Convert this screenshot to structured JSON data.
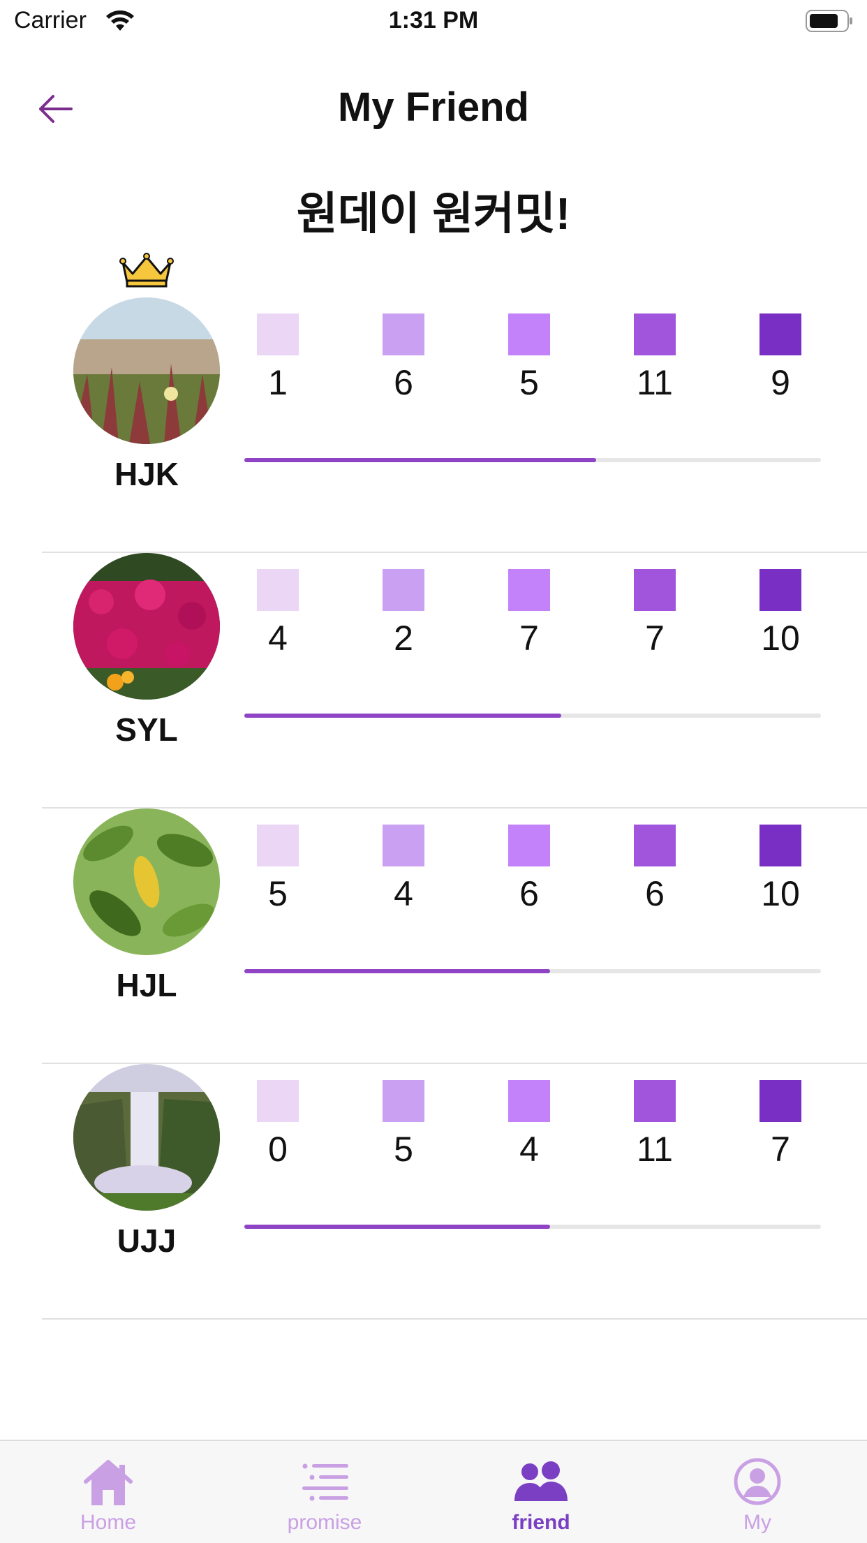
{
  "status_bar": {
    "carrier": "Carrier",
    "time": "1:31 PM"
  },
  "nav": {
    "title": "My Friend",
    "back_icon": "arrow-left-icon"
  },
  "subtitle": "원데이 원커밋!",
  "colors": {
    "accent": "#8e44c4",
    "square_colors": [
      "#ecd6f6",
      "#caa0f2",
      "#c382fa",
      "#a155dd",
      "#7a2fc4"
    ],
    "tab_inactive": "#c9a0e4",
    "tab_active": "#7b3fc4"
  },
  "friends": [
    {
      "name": "HJK",
      "crown": true,
      "counts": [
        "1",
        "6",
        "5",
        "11",
        "9"
      ],
      "progress": 0.61
    },
    {
      "name": "SYL",
      "crown": false,
      "counts": [
        "4",
        "2",
        "7",
        "7",
        "10"
      ],
      "progress": 0.55
    },
    {
      "name": "HJL",
      "crown": false,
      "counts": [
        "5",
        "4",
        "6",
        "6",
        "10"
      ],
      "progress": 0.53
    },
    {
      "name": "UJJ",
      "crown": false,
      "counts": [
        "0",
        "5",
        "4",
        "11",
        "7"
      ],
      "progress": 0.53
    }
  ],
  "tabs": [
    {
      "label": "Home",
      "icon": "home-icon",
      "active": false
    },
    {
      "label": "promise",
      "icon": "list-icon",
      "active": false
    },
    {
      "label": "friend",
      "icon": "people-icon",
      "active": true
    },
    {
      "label": "My",
      "icon": "profile-icon",
      "active": false
    }
  ]
}
